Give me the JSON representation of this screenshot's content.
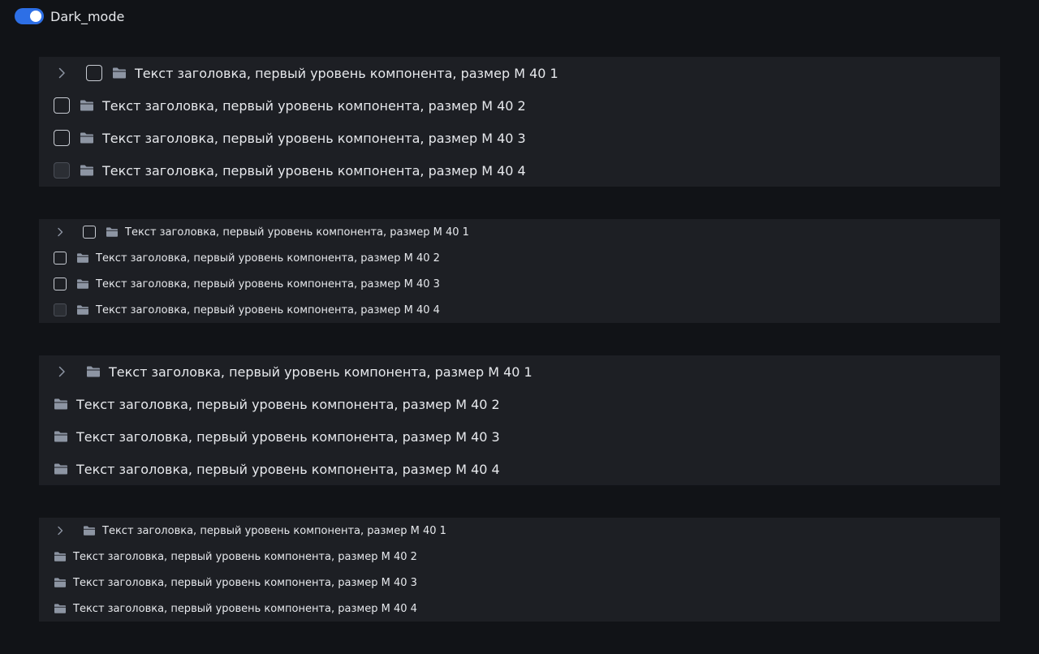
{
  "toggle": {
    "label": "Dark_mode",
    "checked": true,
    "color": "#2d6fe6"
  },
  "colors": {
    "page_bg": "#111317",
    "panel_bg": "#1d1f24",
    "text": "#e6e8ec",
    "icon": "#8d95a3"
  },
  "icons": {
    "expand": "chevron-right-icon",
    "item": "folder-icon"
  },
  "panels": [
    {
      "size": "M",
      "has_checkbox": true,
      "items": [
        {
          "label": "Текст заголовка, первый уровень компонента, размер M 40 1",
          "expandable": true,
          "checkbox": "unchecked"
        },
        {
          "label": "Текст заголовка, первый уровень компонента, размер M 40 2",
          "expandable": false,
          "checkbox": "unchecked"
        },
        {
          "label": "Текст заголовка, первый уровень компонента, размер M 40 3",
          "expandable": false,
          "checkbox": "unchecked"
        },
        {
          "label": "Текст заголовка, первый уровень компонента, размер M 40 4",
          "expandable": false,
          "checkbox": "disabled"
        }
      ]
    },
    {
      "size": "S",
      "has_checkbox": true,
      "items": [
        {
          "label": "Текст заголовка, первый уровень компонента, размер M 40 1",
          "expandable": true,
          "checkbox": "unchecked"
        },
        {
          "label": "Текст заголовка, первый уровень компонента, размер M 40 2",
          "expandable": false,
          "checkbox": "unchecked"
        },
        {
          "label": "Текст заголовка, первый уровень компонента, размер M 40 3",
          "expandable": false,
          "checkbox": "unchecked"
        },
        {
          "label": "Текст заголовка, первый уровень компонента, размер M 40 4",
          "expandable": false,
          "checkbox": "disabled"
        }
      ]
    },
    {
      "size": "M",
      "has_checkbox": false,
      "items": [
        {
          "label": "Текст заголовка, первый уровень компонента, размер M 40 1",
          "expandable": true
        },
        {
          "label": "Текст заголовка, первый уровень компонента, размер M 40 2",
          "expandable": false
        },
        {
          "label": "Текст заголовка, первый уровень компонента, размер M 40 3",
          "expandable": false
        },
        {
          "label": "Текст заголовка, первый уровень компонента, размер M 40 4",
          "expandable": false
        }
      ]
    },
    {
      "size": "S",
      "has_checkbox": false,
      "items": [
        {
          "label": "Текст заголовка, первый уровень компонента, размер M 40 1",
          "expandable": true
        },
        {
          "label": "Текст заголовка, первый уровень компонента, размер M 40 2",
          "expandable": false
        },
        {
          "label": "Текст заголовка, первый уровень компонента, размер M 40 3",
          "expandable": false
        },
        {
          "label": "Текст заголовка, первый уровень компонента, размер M 40 4",
          "expandable": false
        }
      ]
    }
  ]
}
